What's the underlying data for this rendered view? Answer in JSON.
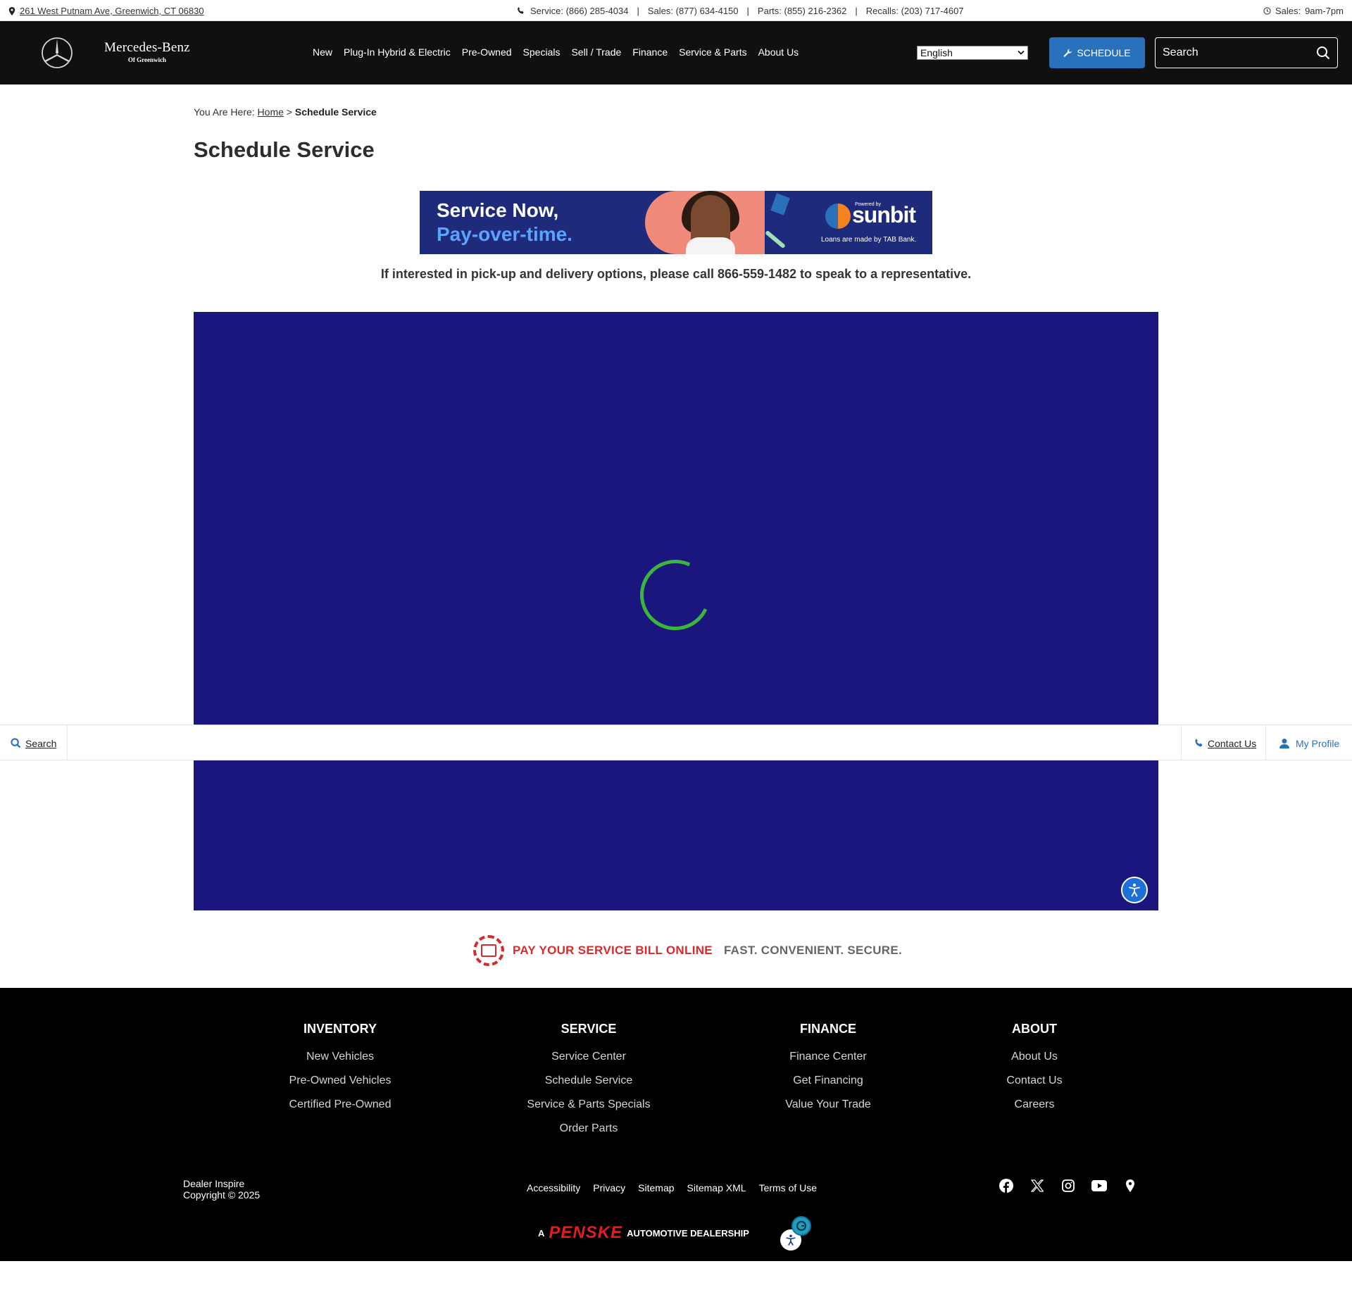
{
  "topbar": {
    "address": "261 West Putnam Ave, Greenwich, CT 06830",
    "service_phone": "Service: (866) 285-4034",
    "sales_phone": "Sales: (877) 634-4150",
    "parts_phone": "Parts: (855) 216-2362",
    "recalls_phone": "Recalls: (203) 717-4607",
    "separator": "|",
    "hours_label": "Sales:",
    "hours_value": "9am-7pm"
  },
  "header": {
    "brand_name": "Mercedes-Benz",
    "brand_sub": "Of Greenwich",
    "nav": [
      "New",
      "Plug-In Hybrid & Electric",
      "Pre-Owned",
      "Specials",
      "Sell / Trade",
      "Finance",
      "Service & Parts",
      "About Us"
    ],
    "language": "English",
    "schedule_label": "SCHEDULE",
    "search_placeholder": "Search"
  },
  "breadcrumb": {
    "prefix": "You Are Here:",
    "home": "Home",
    "divider": ">",
    "current": "Schedule Service"
  },
  "page_title": "Schedule Service",
  "banner": {
    "line1": "Service Now,",
    "line2": "Pay-over-time.",
    "powered_by": "Powered by",
    "brand": "sunbit",
    "disclaimer": "Loans are made by TAB Bank."
  },
  "notice": "If interested in pick-up and delivery options, please call 866-559-1482 to speak to a representative.",
  "sticky": {
    "search": "Search",
    "contact": "Contact Us",
    "profile": "My Profile"
  },
  "paybill": {
    "red": "PAY YOUR SERVICE BILL ONLINE",
    "gray": "FAST. CONVENIENT. SECURE."
  },
  "footer": {
    "columns": [
      {
        "title": "INVENTORY",
        "links": [
          "New Vehicles",
          "Pre-Owned Vehicles",
          "Certified Pre-Owned"
        ]
      },
      {
        "title": "SERVICE",
        "links": [
          "Service Center",
          "Schedule Service",
          "Service & Parts Specials",
          "Order Parts"
        ]
      },
      {
        "title": "FINANCE",
        "links": [
          "Finance Center",
          "Get Financing",
          "Value Your Trade"
        ]
      },
      {
        "title": "ABOUT",
        "links": [
          "About Us",
          "Contact Us",
          "Careers"
        ]
      }
    ],
    "dealer": "Dealer Inspire",
    "copyright": "Copyright © 2025",
    "legal": [
      "Accessibility",
      "Privacy",
      "Sitemap",
      "Sitemap XML",
      "Terms of Use"
    ],
    "social_icons": [
      "facebook-icon",
      "x-icon",
      "instagram-icon",
      "youtube-icon",
      "location-pin-icon"
    ],
    "penske_prefix": "A",
    "penske_brand": "PENSKE",
    "penske_suffix": "AUTOMOTIVE DEALERSHIP"
  },
  "colors": {
    "header_bg": "#101010",
    "accent_blue": "#2a71bb",
    "frame_navy": "#1a167e",
    "spinner_green": "#3ab73a",
    "paybill_red": "#d82a2a",
    "penske_red": "#e31c1c"
  }
}
